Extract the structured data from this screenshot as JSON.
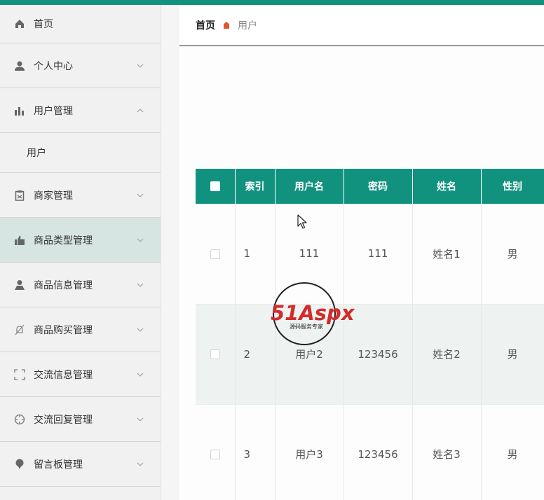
{
  "sidebar": {
    "items": [
      {
        "label": "首页",
        "icon": "home-icon"
      },
      {
        "label": "个人中心",
        "icon": "person-icon"
      },
      {
        "label": "用户管理",
        "icon": "bar-chart-icon"
      },
      {
        "label": "用户"
      },
      {
        "label": "商家管理",
        "icon": "clipboard-icon"
      },
      {
        "label": "商品类型管理",
        "icon": "thumbs-up-icon"
      },
      {
        "label": "商品信息管理",
        "icon": "person-icon"
      },
      {
        "label": "商品购买管理",
        "icon": "bell-off-icon"
      },
      {
        "label": "交流信息管理",
        "icon": "frame-icon"
      },
      {
        "label": "交流回复管理",
        "icon": "crosshair-icon"
      },
      {
        "label": "留言板管理",
        "icon": "pin-icon"
      }
    ]
  },
  "breadcrumb": {
    "home": "首页",
    "current": "用户"
  },
  "table": {
    "headers": [
      "索引",
      "用户名",
      "密码",
      "姓名",
      "性别"
    ],
    "rows": [
      {
        "index": "1",
        "username": "111",
        "password": "111",
        "name": "姓名1",
        "gender": "男"
      },
      {
        "index": "2",
        "username": "用户2",
        "password": "123456",
        "name": "姓名2",
        "gender": "男"
      },
      {
        "index": "3",
        "username": "用户3",
        "password": "123456",
        "name": "姓名3",
        "gender": "男"
      }
    ]
  },
  "watermark": {
    "brand": "51Aspx",
    "tagline": "源码服务专家"
  },
  "colors": {
    "accent": "#11927f",
    "active_bg": "#d6e5e1",
    "watermark_red": "#d42a2a",
    "watermark_green": "#3a9d3a"
  }
}
